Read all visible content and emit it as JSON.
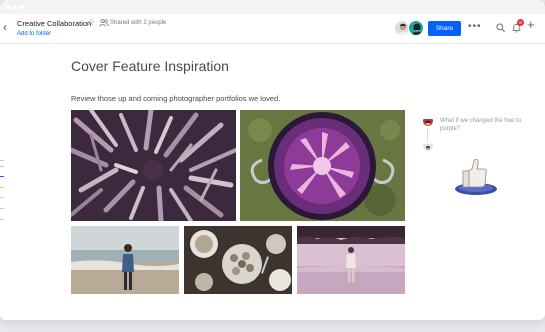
{
  "header": {
    "doc_title": "Creative Collaboration",
    "shared_text": "Shared with 2 people",
    "add_to_folder": "Add to folder",
    "share_label": "Share",
    "notification_count": "8",
    "more_label": "•••"
  },
  "page": {
    "title": "Cover Feature Inspiration",
    "subtitle": "Review those up and coming photographer portfolios we loved."
  },
  "comments": {
    "text": "What if we changed the hue to purple?"
  },
  "icons": {
    "back": "chevron-left-icon",
    "star": "star-icon",
    "people": "people-icon",
    "search": "search-icon",
    "bell": "bell-icon",
    "plus": "plus-icon"
  },
  "colors": {
    "accent": "#0061fe",
    "badge": "#e5322d"
  }
}
